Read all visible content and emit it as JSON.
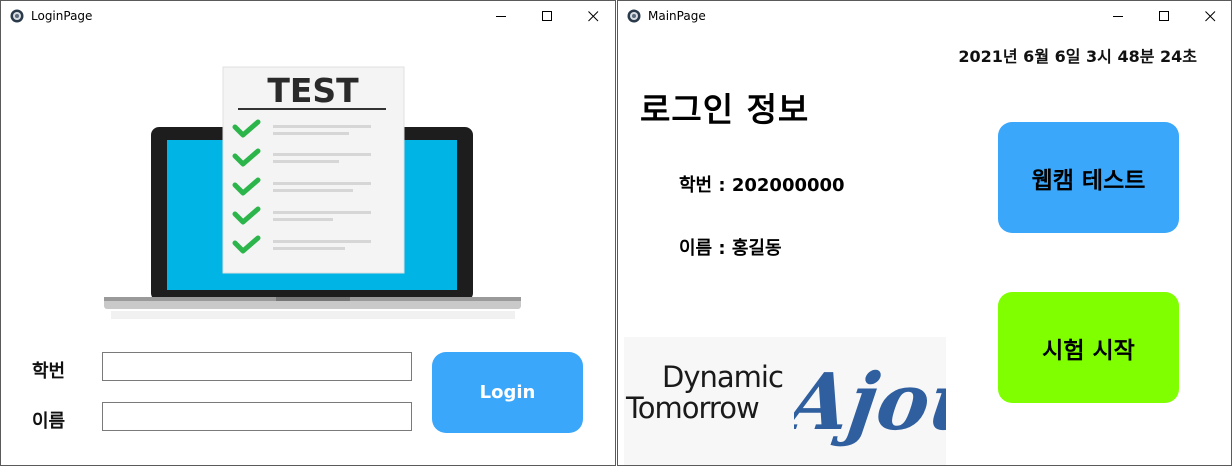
{
  "login_window": {
    "title": "LoginPage",
    "illustration_text": "TEST",
    "student_id_label": "학번",
    "name_label": "이름",
    "student_id_value": "",
    "name_value": "",
    "login_button": "Login"
  },
  "main_window": {
    "title": "MainPage",
    "datetime": "2021년 6월 6일 3시 48분 24초",
    "heading": "로그인 정보",
    "student_id_line": "학번 : 202000000",
    "name_line": "이름 : 홍길동",
    "webcam_button": "웹캠 테스트",
    "exam_button": "시험 시작",
    "logo": {
      "line1": "Dynamic",
      "line2": "Tomorrow",
      "brand": "Ajou"
    }
  },
  "colors": {
    "accent_blue": "#3aa7fb",
    "accent_green": "#80ff00",
    "screen_blue": "#00b4e6",
    "check_green": "#2cb54a",
    "logo_blue": "#2f5f9e"
  },
  "icons": {
    "app": "qt-app-icon",
    "minimize": "minimize-icon",
    "maximize": "maximize-icon",
    "close": "close-icon"
  }
}
